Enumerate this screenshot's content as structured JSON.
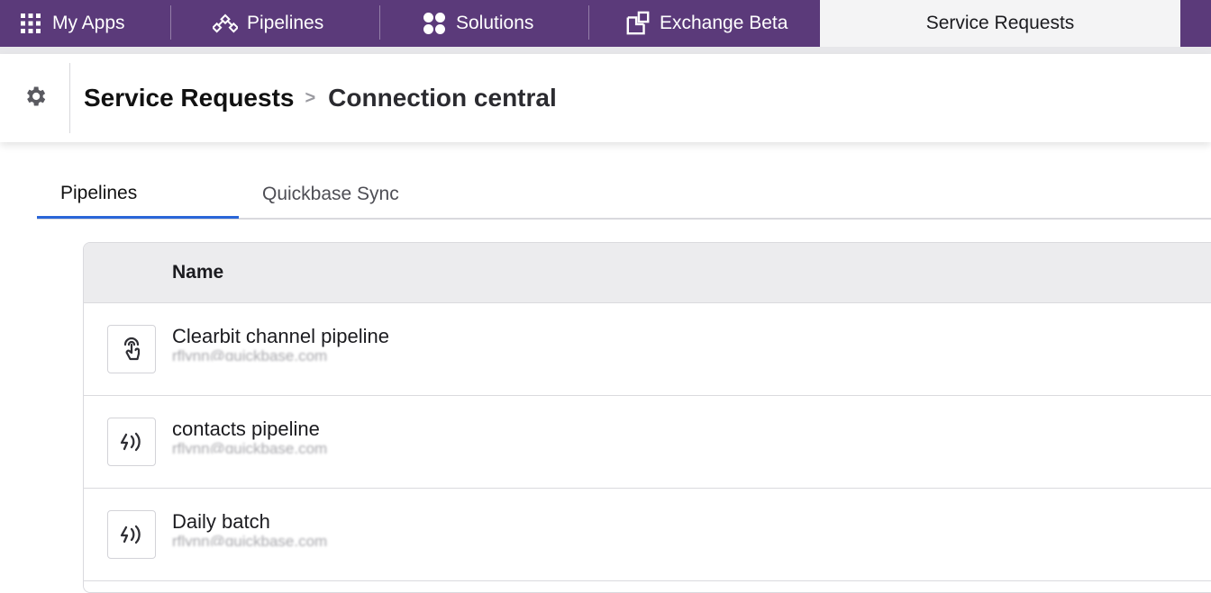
{
  "topnav": {
    "tabs": [
      {
        "label": "My Apps",
        "icon": "grid-icon"
      },
      {
        "label": "Pipelines",
        "icon": "pipelines-icon"
      },
      {
        "label": "Solutions",
        "icon": "solutions-icon"
      },
      {
        "label": "Exchange Beta",
        "icon": "exchange-icon"
      },
      {
        "label": "Service Requests",
        "active": true
      }
    ]
  },
  "header": {
    "breadcrumb_root": "Service Requests",
    "breadcrumb_separator": ">",
    "breadcrumb_current": "Connection central"
  },
  "tabs": [
    {
      "label": "Pipelines",
      "active": true
    },
    {
      "label": "Quickbase Sync"
    }
  ],
  "table": {
    "columns": [
      "Name"
    ],
    "rows": [
      {
        "title": "Clearbit channel pipeline",
        "subtitle": "rflynn@quickbase.com",
        "icon": "touch-icon"
      },
      {
        "title": "contacts pipeline",
        "subtitle": "rflynn@quickbase.com",
        "icon": "trigger-icon"
      },
      {
        "title": "Daily batch",
        "subtitle": "rflynn@quickbase.com",
        "icon": "trigger-icon"
      }
    ]
  },
  "colors": {
    "nav_bg": "#5b3a7a",
    "active_tab_underline": "#2a66d8"
  }
}
